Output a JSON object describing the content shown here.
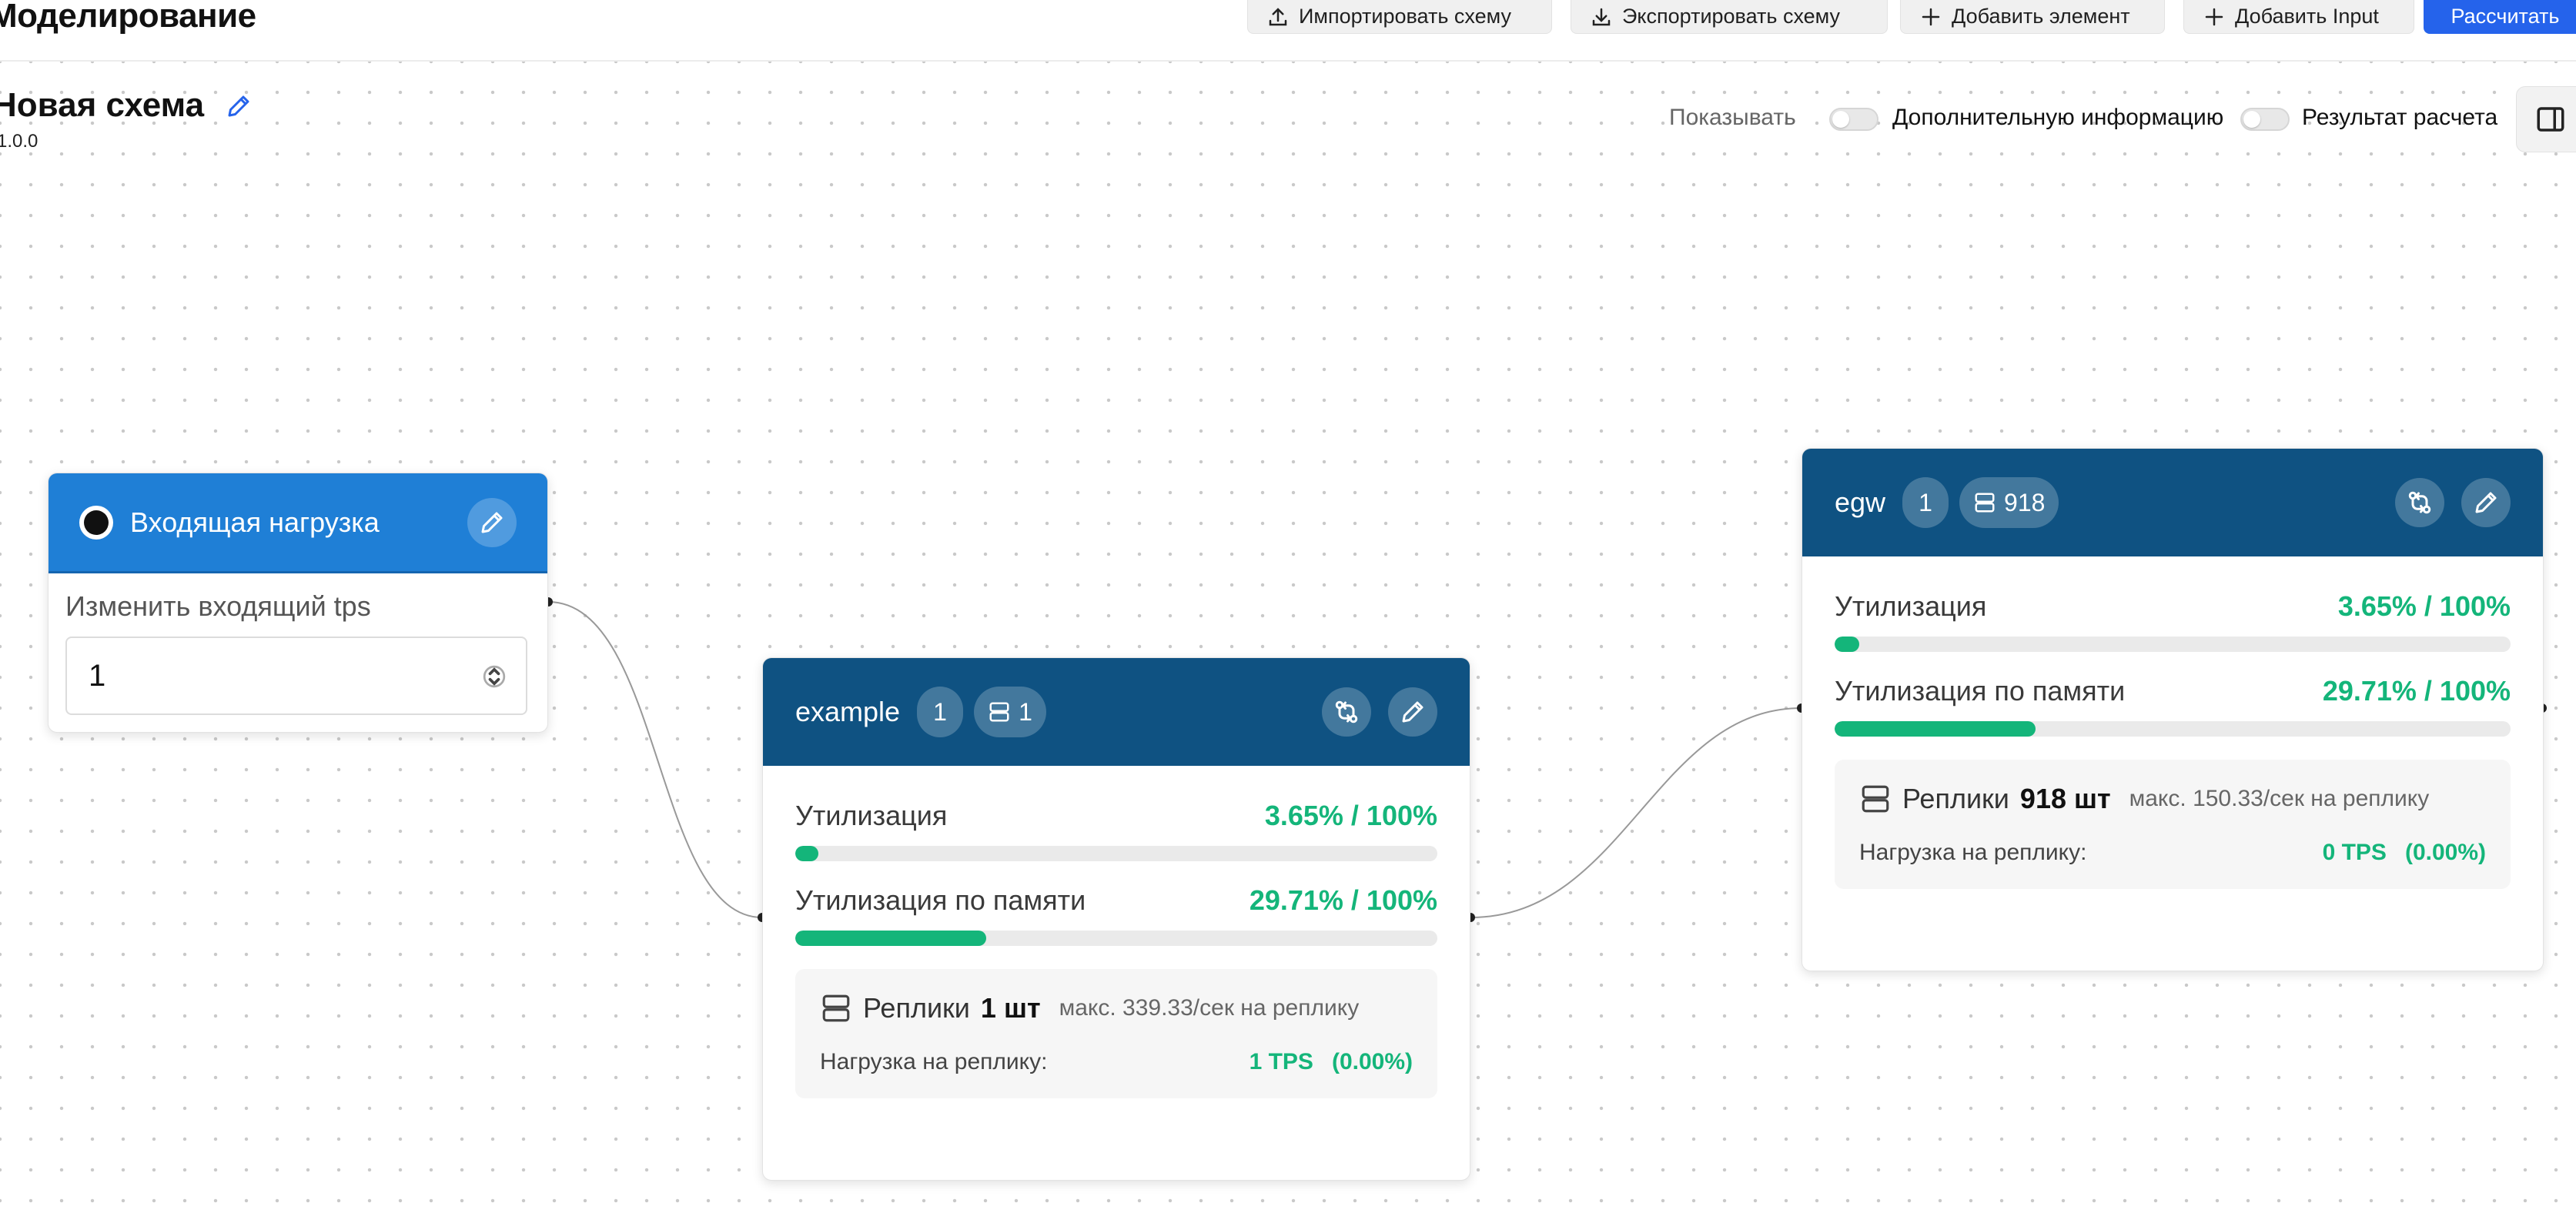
{
  "page": {
    "title": "Моделирование"
  },
  "toolbar": {
    "import_label": "Импортировать схему",
    "export_label": "Экспортировать схему",
    "add_element_label": "Добавить элемент",
    "add_input_label": "Добавить Input",
    "calculate_label": "Рассчитать",
    "accent_color": "#2563eb"
  },
  "schema": {
    "name": "Новая схема",
    "version": "1.0.0"
  },
  "display": {
    "show_label": "Показывать",
    "extra_info_label": "Дополнительную информацию",
    "extra_info_on": false,
    "result_label": "Результат расчета",
    "result_on": false
  },
  "input_node": {
    "title": "Входящая нагрузка",
    "field_label": "Изменить входящий tps",
    "tps_value": "1",
    "header_color": "#1f7fd6"
  },
  "nodes": [
    {
      "title": "example",
      "count": "1",
      "replicas_badge": "1",
      "utilization_label": "Утилизация",
      "utilization_value": "3.65% / 100%",
      "utilization_fraction": 0.0365,
      "memory_label": "Утилизация по памяти",
      "memory_value": "29.71% / 100%",
      "memory_fraction": 0.2971,
      "replicas_label": "Реплики",
      "replicas_count": "1 шт",
      "replicas_max": "макс. 339.33/сек на реплику",
      "load_label": "Нагрузка на реплику:",
      "load_tps": "1 TPS",
      "load_pct": "(0.00%)"
    },
    {
      "title": "egw",
      "count": "1",
      "replicas_badge": "918",
      "utilization_label": "Утилизация",
      "utilization_value": "3.65% / 100%",
      "utilization_fraction": 0.0365,
      "memory_label": "Утилизация по памяти",
      "memory_value": "29.71% / 100%",
      "memory_fraction": 0.2971,
      "replicas_label": "Реплики",
      "replicas_count": "918 шт",
      "replicas_max": "макс. 150.33/сек на реплику",
      "load_label": "Нагрузка на реплику:",
      "load_tps": "0 TPS",
      "load_pct": "(0.00%)"
    }
  ],
  "colors": {
    "node_header": "#0f5282",
    "metric_green": "#14b57a"
  }
}
